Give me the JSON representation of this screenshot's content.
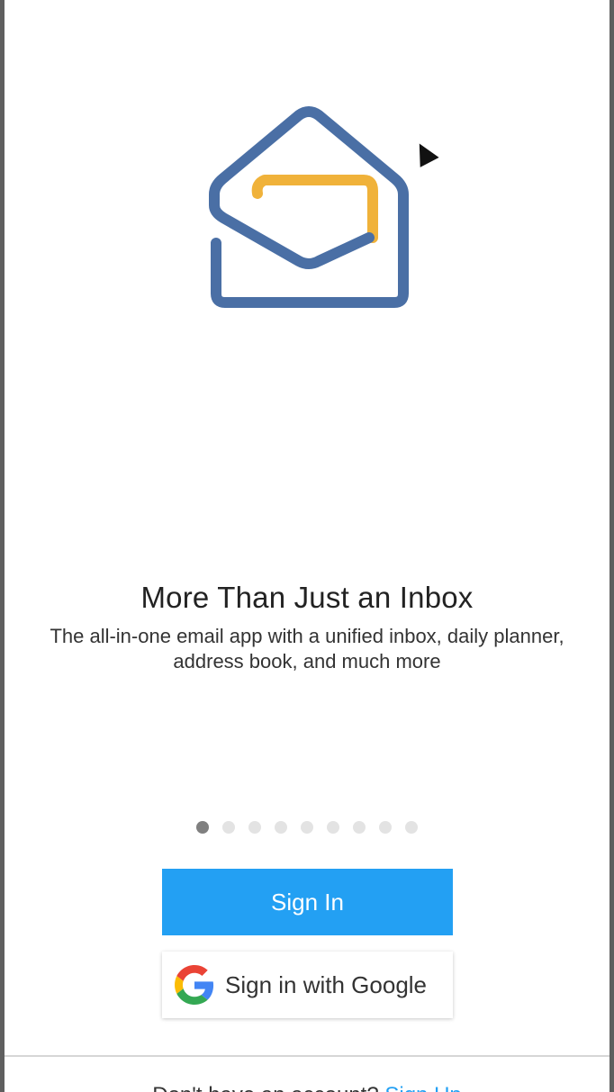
{
  "onboarding": {
    "title": "More Than Just an Inbox",
    "description": "The all-in-one email app with a unified inbox, daily planner, address book, and much more",
    "page_indicator": {
      "total": 9,
      "active_index": 0
    }
  },
  "actions": {
    "sign_in_label": "Sign In",
    "google_label": "Sign in with Google"
  },
  "footer": {
    "prompt": "Don't have an account?",
    "link": "Sign Up"
  },
  "icons": {
    "logo": "envelope-house-logo",
    "google": "google-g-icon",
    "cursor": "mouse-pointer-icon"
  },
  "colors": {
    "accent": "#23a0f3",
    "logo_blue": "#4a6fa5",
    "logo_yellow": "#f0b23a",
    "dot_active": "#808080",
    "dot_inactive": "#e3e3e3"
  }
}
